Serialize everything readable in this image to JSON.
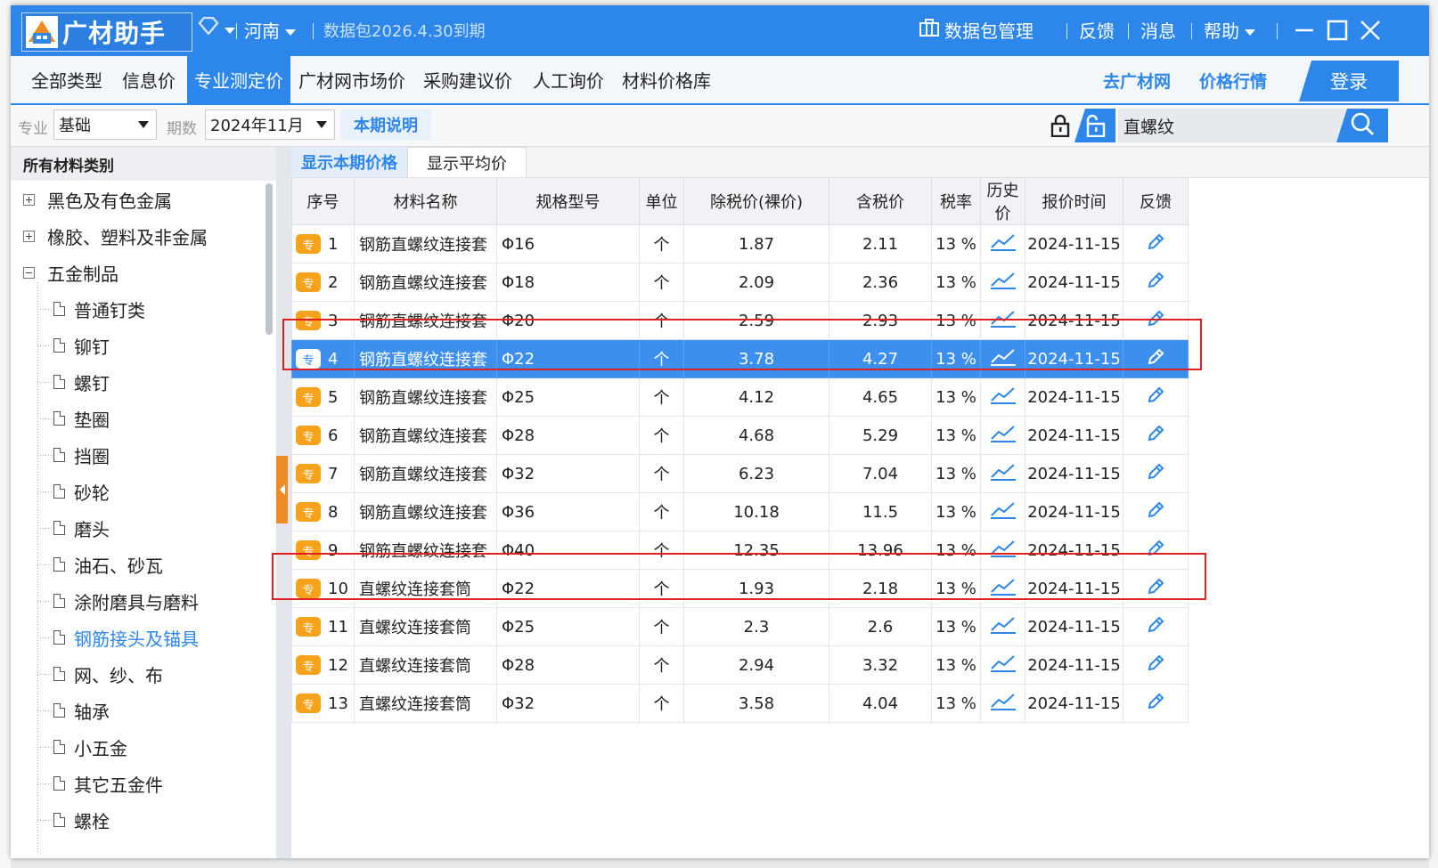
{
  "titlebar": {
    "app_name": "广材助手",
    "region": "河南",
    "data_package": "数据包2026.4.30到期",
    "data_pkg_mgmt": "数据包管理",
    "feedback": "反馈",
    "messages": "消息",
    "help": "帮助"
  },
  "nav": {
    "tabs": [
      "全部类型",
      "信息价",
      "专业测定价",
      "广材网市场价",
      "采购建议价",
      "人工询价",
      "材料价格库"
    ],
    "active_tab": "专业测定价",
    "go_site": "去广材网",
    "price_trend": "价格行情",
    "login": "登录"
  },
  "filter": {
    "major_label": "专业",
    "major_value": "基础",
    "period_label": "期数",
    "period_value": "2024年11月",
    "note_button": "本期说明",
    "search_value": "直螺纹"
  },
  "sidebar": {
    "header": "所有材料类别",
    "groups": [
      {
        "label": "黑色及有色金属",
        "expanded": false
      },
      {
        "label": "橡胶、塑料及非金属",
        "expanded": false
      },
      {
        "label": "五金制品",
        "expanded": true
      }
    ],
    "children": [
      "普通钉类",
      "铆钉",
      "螺钉",
      "垫圈",
      "挡圈",
      "砂轮",
      "磨头",
      "油石、砂瓦",
      "涂附磨具与磨料",
      "钢筋接头及锚具",
      "网、纱、布",
      "轴承",
      "小五金",
      "其它五金件",
      "螺栓"
    ],
    "selected_child": "钢筋接头及锚具"
  },
  "subtabs": [
    "显示本期价格",
    "显示平均价"
  ],
  "table": {
    "columns": [
      "序号",
      "材料名称",
      "规格型号",
      "单位",
      "除税价(裸价)",
      "含税价",
      "税率",
      "历史价",
      "报价时间",
      "反馈"
    ],
    "badge": "专",
    "rows": [
      {
        "no": "1",
        "name": "钢筋直螺纹连接套",
        "spec": "Φ16",
        "unit": "个",
        "price": "1.87",
        "tax_price": "2.11",
        "rate": "13 %",
        "date": "2024-11-15"
      },
      {
        "no": "2",
        "name": "钢筋直螺纹连接套",
        "spec": "Φ18",
        "unit": "个",
        "price": "2.09",
        "tax_price": "2.36",
        "rate": "13 %",
        "date": "2024-11-15"
      },
      {
        "no": "3",
        "name": "钢筋直螺纹连接套",
        "spec": "Φ20",
        "unit": "个",
        "price": "2.59",
        "tax_price": "2.93",
        "rate": "13 %",
        "date": "2024-11-15"
      },
      {
        "no": "4",
        "name": "钢筋直螺纹连接套",
        "spec": "Φ22",
        "unit": "个",
        "price": "3.78",
        "tax_price": "4.27",
        "rate": "13 %",
        "date": "2024-11-15"
      },
      {
        "no": "5",
        "name": "钢筋直螺纹连接套",
        "spec": "Φ25",
        "unit": "个",
        "price": "4.12",
        "tax_price": "4.65",
        "rate": "13 %",
        "date": "2024-11-15"
      },
      {
        "no": "6",
        "name": "钢筋直螺纹连接套",
        "spec": "Φ28",
        "unit": "个",
        "price": "4.68",
        "tax_price": "5.29",
        "rate": "13 %",
        "date": "2024-11-15"
      },
      {
        "no": "7",
        "name": "钢筋直螺纹连接套",
        "spec": "Φ32",
        "unit": "个",
        "price": "6.23",
        "tax_price": "7.04",
        "rate": "13 %",
        "date": "2024-11-15"
      },
      {
        "no": "8",
        "name": "钢筋直螺纹连接套",
        "spec": "Φ36",
        "unit": "个",
        "price": "10.18",
        "tax_price": "11.5",
        "rate": "13 %",
        "date": "2024-11-15"
      },
      {
        "no": "9",
        "name": "钢筋直螺纹连接套",
        "spec": "Φ40",
        "unit": "个",
        "price": "12.35",
        "tax_price": "13.96",
        "rate": "13 %",
        "date": "2024-11-15"
      },
      {
        "no": "10",
        "name": "直螺纹连接套筒",
        "spec": "Φ22",
        "unit": "个",
        "price": "1.93",
        "tax_price": "2.18",
        "rate": "13 %",
        "date": "2024-11-15"
      },
      {
        "no": "11",
        "name": "直螺纹连接套筒",
        "spec": "Φ25",
        "unit": "个",
        "price": "2.3",
        "tax_price": "2.6",
        "rate": "13 %",
        "date": "2024-11-15"
      },
      {
        "no": "12",
        "name": "直螺纹连接套筒",
        "spec": "Φ28",
        "unit": "个",
        "price": "2.94",
        "tax_price": "3.32",
        "rate": "13 %",
        "date": "2024-11-15"
      },
      {
        "no": "13",
        "name": "直螺纹连接套筒",
        "spec": "Φ32",
        "unit": "个",
        "price": "3.58",
        "tax_price": "4.04",
        "rate": "13 %",
        "date": "2024-11-15"
      }
    ],
    "selected_row": 4
  },
  "colors": {
    "brand": "#2d86ea",
    "badge": "#f7a21b",
    "highlight": "#e02020"
  },
  "icons": [
    "diamond-icon",
    "lock-icon",
    "unlock-icon",
    "search-icon",
    "history-chart-icon",
    "edit-pencil-icon",
    "minimize-icon",
    "maximize-icon",
    "close-icon"
  ]
}
